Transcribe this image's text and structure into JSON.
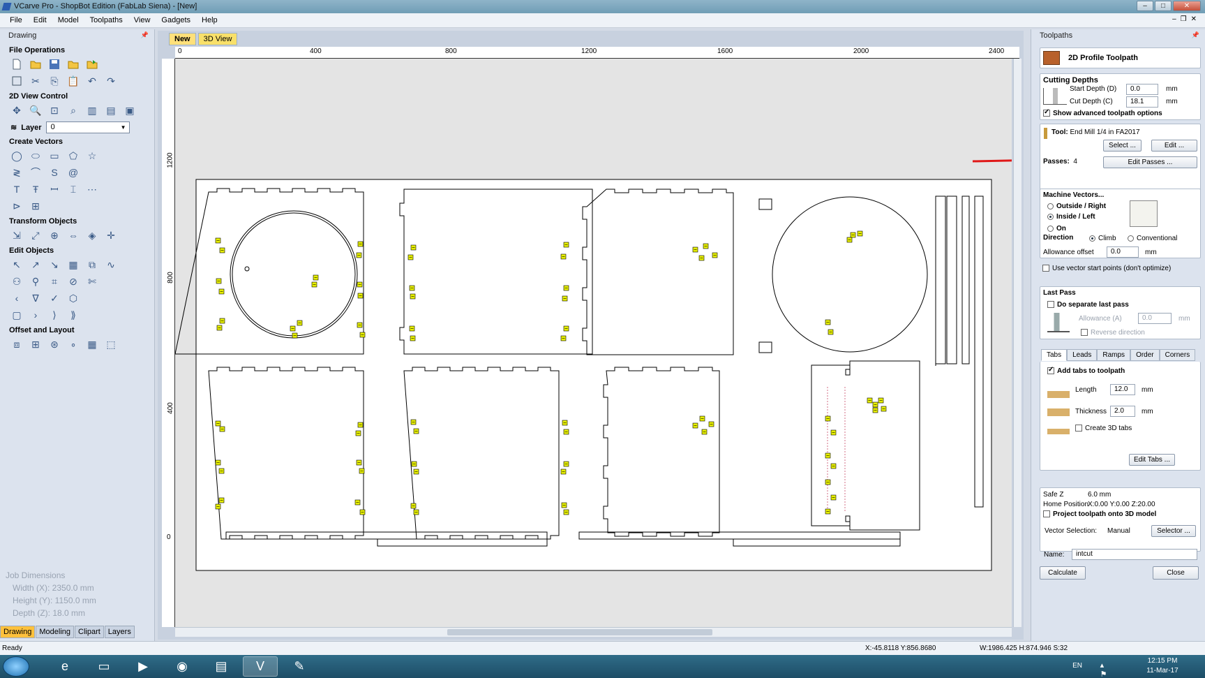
{
  "window": {
    "title": "VCarve Pro - ShopBot Edition (FabLab Siena) - [New]"
  },
  "menu": [
    "File",
    "Edit",
    "Model",
    "Toolpaths",
    "View",
    "Gadgets",
    "Help"
  ],
  "left": {
    "panel_title": "Drawing",
    "sections": {
      "file_ops": "File Operations",
      "view_control": "2D View Control",
      "create_vectors": "Create Vectors",
      "transform": "Transform Objects",
      "edit": "Edit Objects",
      "offset": "Offset and Layout"
    },
    "layer_label": "Layer",
    "layer_value": "0",
    "job": {
      "title": "Job Dimensions",
      "width": "Width  (X): 2350.0 mm",
      "height": "Height (Y): 1150.0 mm",
      "depth": "Depth  (Z): 18.0 mm"
    },
    "tabs": [
      "Drawing",
      "Modeling",
      "Clipart",
      "Layers"
    ]
  },
  "doc": {
    "tabs": [
      "New",
      "3D View"
    ],
    "ruler_h": [
      "0",
      "400",
      "800",
      "1200",
      "1600",
      "2000",
      "2400"
    ],
    "ruler_v": [
      "1200",
      "800",
      "400",
      "0"
    ]
  },
  "right": {
    "panel_title": "Toolpaths",
    "toolpath_title": "2D Profile Toolpath",
    "cutting_depths": "Cutting Depths",
    "start_depth_label": "Start Depth (D)",
    "start_depth": "0.0",
    "cut_depth_label": "Cut Depth (C)",
    "cut_depth": "18.1",
    "unit": "mm",
    "show_adv": "Show advanced toolpath options",
    "tool_label": "Tool:",
    "tool_name": "End Mill 1/4 in FA2017",
    "select_btn": "Select ...",
    "edit_btn": "Edit ...",
    "passes_label": "Passes:",
    "passes": "4",
    "edit_passes_btn": "Edit Passes ...",
    "machine_vectors": "Machine Vectors...",
    "outside": "Outside / Right",
    "inside": "Inside / Left",
    "on": "On",
    "direction": "Direction",
    "climb": "Climb",
    "conventional": "Conventional",
    "allowance_label": "Allowance offset",
    "allowance": "0.0",
    "use_start": "Use vector start points (don't optimize)",
    "last_pass": "Last Pass",
    "do_separate": "Do separate last pass",
    "allowance_a_label": "Allowance (A)",
    "allowance_a": "0.0",
    "reverse": "Reverse direction",
    "tabs": [
      "Tabs",
      "Leads",
      "Ramps",
      "Order",
      "Corners"
    ],
    "add_tabs": "Add tabs to toolpath",
    "length_label": "Length",
    "length": "12.0",
    "thickness_label": "Thickness",
    "thickness": "2.0",
    "create3d": "Create 3D tabs",
    "edit_tabs_btn": "Edit Tabs ...",
    "safe_z_label": "Safe Z",
    "safe_z": "6.0 mm",
    "home_label": "Home Position",
    "home": "X:0.00 Y:0.00 Z:20.00",
    "project": "Project toolpath onto 3D model",
    "vector_sel_label": "Vector Selection:",
    "vector_sel": "Manual",
    "selector_btn": "Selector ...",
    "name_label": "Name:",
    "name_value": "intcut",
    "calculate_btn": "Calculate",
    "close_btn": "Close"
  },
  "status": {
    "ready": "Ready",
    "coords": "X:-45.8118 Y:856.8680",
    "dims": "W:1986.425  H:874.946  S:32"
  },
  "tray": {
    "lang": "EN",
    "time": "12:15 PM",
    "date": "11-Mar-17"
  },
  "colors": {
    "accent_tab": "#ffc13c",
    "tab_marker": "#e8f000",
    "red_arrow": "#e01818"
  }
}
